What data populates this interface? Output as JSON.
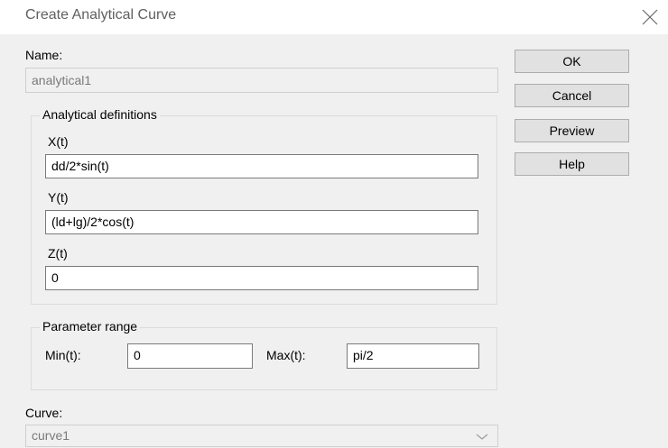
{
  "window": {
    "title": "Create Analytical Curve"
  },
  "name": {
    "label": "Name:",
    "value": "analytical1"
  },
  "analytical": {
    "group_title": "Analytical definitions",
    "x_label": "X(t)",
    "x_value": "dd/2*sin(t)",
    "y_label": "Y(t)",
    "y_value": "(ld+lg)/2*cos(t)",
    "z_label": "Z(t)",
    "z_value": "0"
  },
  "param": {
    "group_title": "Parameter range",
    "min_label": "Min(t):",
    "min_value": "0",
    "max_label": "Max(t):",
    "max_value": "pi/2"
  },
  "curve": {
    "label": "Curve:",
    "value": "curve1"
  },
  "buttons": {
    "ok": "OK",
    "cancel": "Cancel",
    "preview": "Preview",
    "help": "Help"
  }
}
